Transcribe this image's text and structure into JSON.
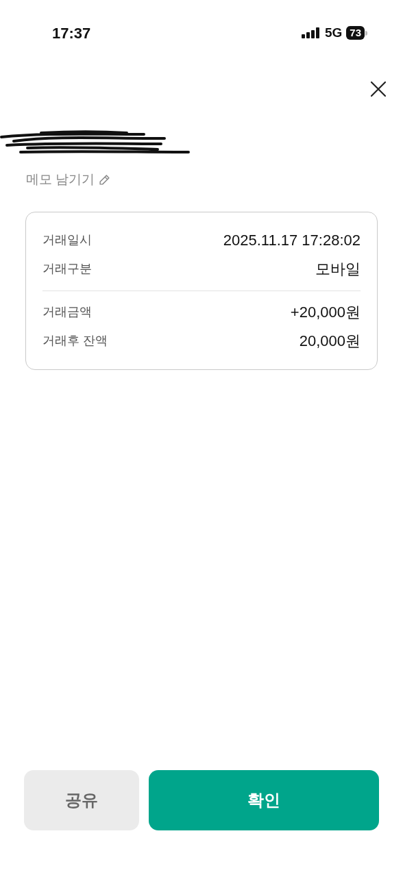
{
  "status_bar": {
    "time": "17:37",
    "network": "5G",
    "battery": "73"
  },
  "memo": {
    "label": "메모 남기기"
  },
  "detail_groups": [
    [
      {
        "label": "거래일시",
        "value": "2025.11.17 17:28:02"
      },
      {
        "label": "거래구분",
        "value": "모바일"
      }
    ],
    [
      {
        "label": "거래금액",
        "value": "+20,000원"
      },
      {
        "label": "거래후 잔액",
        "value": "20,000원"
      }
    ]
  ],
  "buttons": [
    {
      "label": "공유",
      "kind": "secondary"
    },
    {
      "label": "확인",
      "kind": "primary"
    }
  ]
}
